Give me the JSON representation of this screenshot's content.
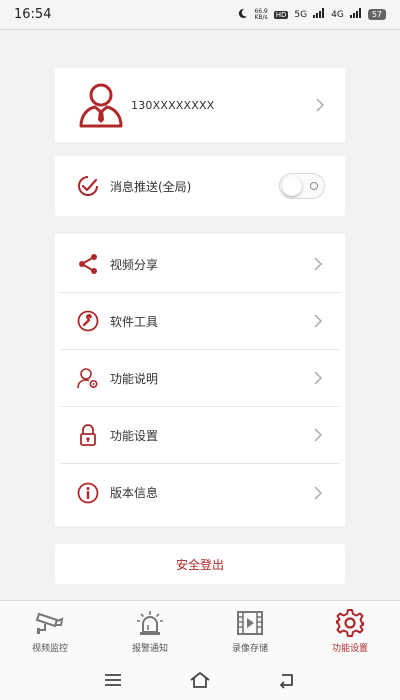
{
  "status_bar": {
    "time": "16:54",
    "speed_value": "66.9",
    "speed_unit": "KB/s",
    "hd": "HD",
    "network1": "5G",
    "network2": "4G",
    "battery": "57"
  },
  "profile": {
    "phone": "130XXXXXXXX",
    "avatar_icon": "user-avatar-icon"
  },
  "push": {
    "label": "消息推送(全局)",
    "icon": "check-circle-icon",
    "enabled": false
  },
  "menu": [
    {
      "key": "share",
      "label": "视频分享",
      "icon": "share-icon"
    },
    {
      "key": "tools",
      "label": "软件工具",
      "icon": "wrench-icon"
    },
    {
      "key": "help",
      "label": "功能说明",
      "icon": "user-gear-icon"
    },
    {
      "key": "settings",
      "label": "功能设置",
      "icon": "lock-icon"
    },
    {
      "key": "version",
      "label": "版本信息",
      "icon": "info-icon"
    }
  ],
  "logout": {
    "label": "安全登出"
  },
  "tabs": [
    {
      "label": "视频监控",
      "icon": "cctv-camera-icon",
      "active": false
    },
    {
      "label": "报警通知",
      "icon": "alarm-siren-icon",
      "active": false
    },
    {
      "label": "录像存储",
      "icon": "video-film-icon",
      "active": false
    },
    {
      "label": "功能设置",
      "icon": "gear-icon",
      "active": true
    }
  ],
  "colors": {
    "accent": "#b0282a",
    "background": "#f2f2f2",
    "card": "#ffffff",
    "inactive_tab": "#777777"
  },
  "nav": {
    "menu_icon": "menu-lines-icon",
    "home_icon": "home-icon",
    "back_icon": "back-icon"
  }
}
